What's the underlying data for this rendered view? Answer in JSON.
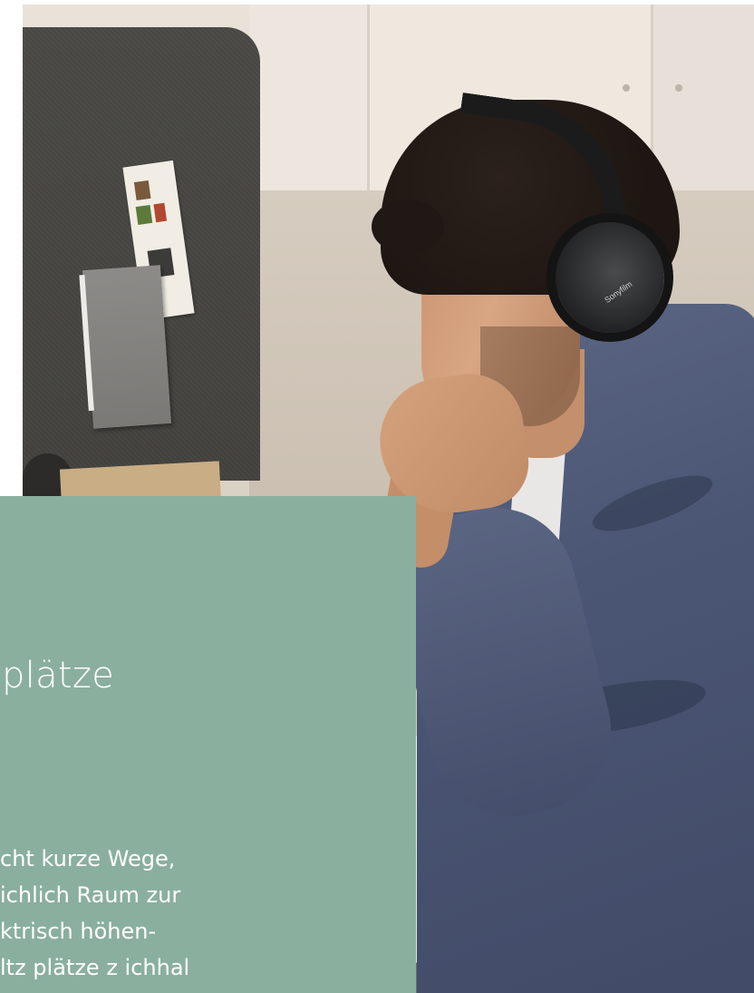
{
  "photo": {
    "alt": "",
    "headphone_brand": "Sonyfilm"
  },
  "panel": {
    "background_color": "#8aaf9f",
    "title": "plätze",
    "body_lines": [
      "cht kurze Wege,",
      "ichlich Raum zur",
      "ktrisch höhen-",
      "ltz plätze  z  ichhal"
    ]
  }
}
